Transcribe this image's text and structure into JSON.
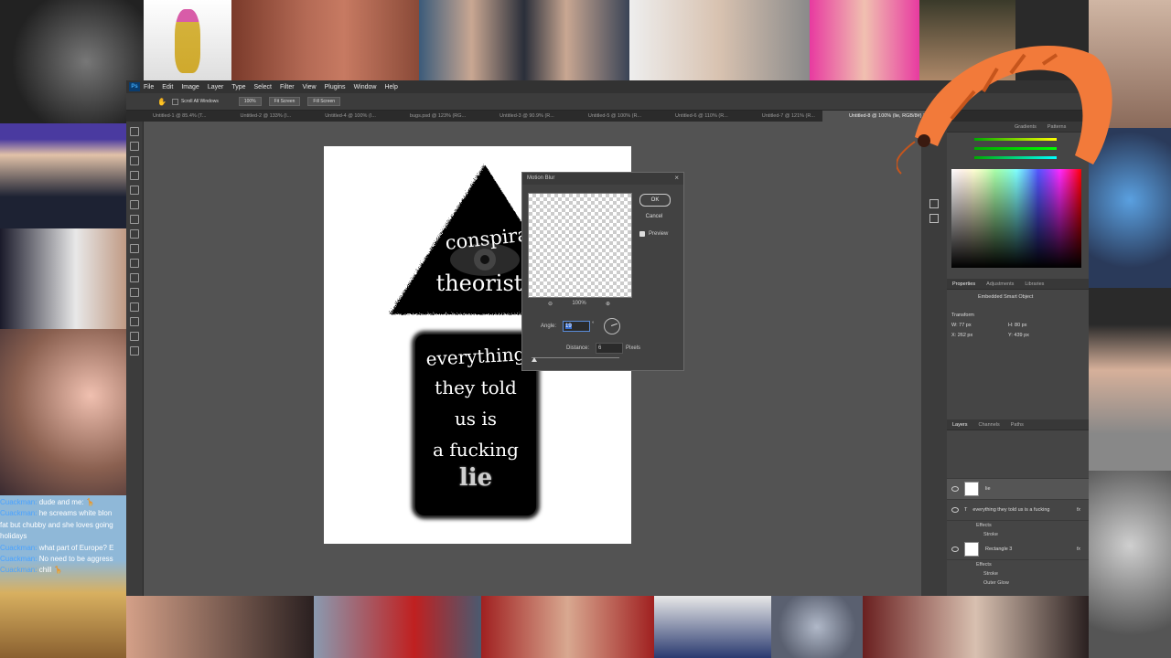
{
  "menu": {
    "logo": "Ps",
    "items": [
      "File",
      "Edit",
      "Image",
      "Layer",
      "Type",
      "Select",
      "Filter",
      "View",
      "Plugins",
      "Window",
      "Help"
    ]
  },
  "options_bar": {
    "scroll_all": "Scroll All Windows",
    "zoom": "100%",
    "fit_screen": "Fit Screen",
    "fill_screen": "Fill Screen"
  },
  "doc_tabs": [
    "Untitled-1 @ 85.4% (T...",
    "Untitled-2 @ 133% (I...",
    "Untitled-4 @ 100% (I...",
    "bugs.psd @ 123% (RG...",
    "Untitled-3 @ 90.9% (R...",
    "Untitled-5 @ 100% (R...",
    "Untitled-6 @ 110% (R...",
    "Untitled-7 @ 121% (R...",
    "Untitled-8 @ 100% (lie, RGB/8#) *"
  ],
  "artwork": {
    "triangle_line1": "conspiracy",
    "triangle_line2": "theorist",
    "sign_line1": "everything",
    "sign_line2": "they told",
    "sign_line3": "us is",
    "sign_line4": "a fucking",
    "sign_line5": "lie"
  },
  "dialog": {
    "title": "Motion Blur",
    "ok": "OK",
    "cancel": "Cancel",
    "preview": "Preview",
    "zoom": "100%",
    "angle_label": "Angle:",
    "angle_value": "19",
    "angle_unit": "°",
    "distance_label": "Distance:",
    "distance_value": "6",
    "distance_unit": "Pixels"
  },
  "panels": {
    "top_tabs": [
      "Gradients",
      "Patterns"
    ],
    "properties_tabs": [
      "Properties",
      "Adjustments",
      "Libraries"
    ],
    "smart_object": "Embedded Smart Object",
    "transform": "Transform",
    "w": "W: 77 px",
    "h": "H: 80 px",
    "x": "X: 262 px",
    "y": "Y: 439 px",
    "layers_tabs": [
      "Layers",
      "Channels",
      "Paths"
    ],
    "layers": [
      {
        "name": "lie",
        "fx": ""
      },
      {
        "name": "everything they told us is a fucking",
        "fx": "fx"
      },
      {
        "name": "Rectangle 3",
        "fx": "fx"
      }
    ],
    "sublabels": {
      "effects1": "Effects",
      "stroke1": "Stroke",
      "effects2": "Effects",
      "stroke2": "Stroke",
      "outer_glow": "Outer Glow"
    }
  },
  "chat": [
    {
      "user": "Cuackman:",
      "text": " dude and me: 🦒"
    },
    {
      "user": "Cuackman:",
      "text": " he screams white blon"
    },
    {
      "user": "",
      "text": "fat but chubby and she loves going"
    },
    {
      "user": "",
      "text": "holidays"
    },
    {
      "user": "Cuackman:",
      "text": " what part of Europe? E"
    },
    {
      "user": "Cuackman:",
      "text": " No need to be aggress"
    },
    {
      "user": "Cuackman:",
      "text": " chill 🦒"
    }
  ],
  "overlay": {
    "shrimp_icon": "shrimp-icon",
    "meme_tiles": "meme-face-images"
  },
  "colors": {
    "ps_bg": "#535353",
    "accent_chat_user": "#4ba3ff",
    "highlight": "#3a6fd0"
  }
}
